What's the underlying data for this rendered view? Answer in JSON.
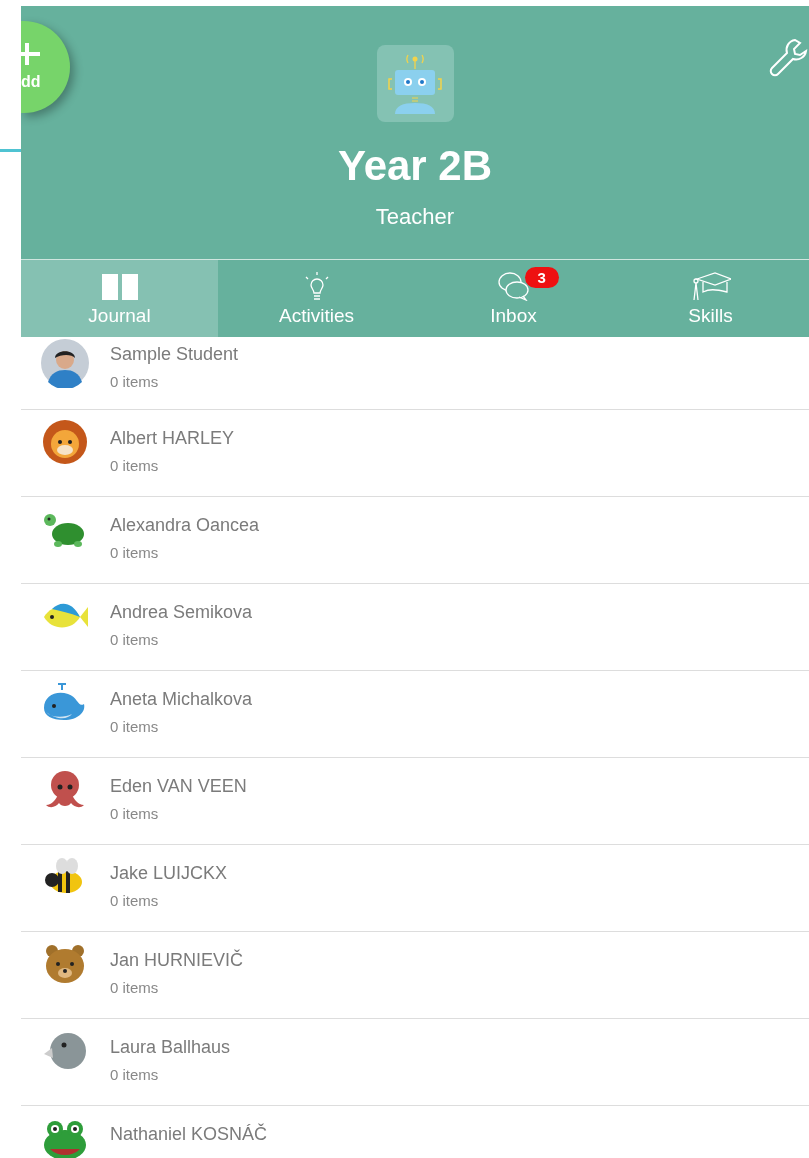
{
  "add_button": {
    "label": "dd"
  },
  "header": {
    "title": "Year 2B",
    "subtitle": "Teacher"
  },
  "tabs": [
    {
      "label": "Journal",
      "kind": "book",
      "selected": true
    },
    {
      "label": "Activities",
      "kind": "bulb",
      "selected": false
    },
    {
      "label": "Inbox",
      "kind": "chat",
      "selected": false,
      "badge": "3"
    },
    {
      "label": "Skills",
      "kind": "cap",
      "selected": false
    }
  ],
  "students": [
    {
      "name": "Sample Student",
      "items": "0 items",
      "kind": "person"
    },
    {
      "name": "Albert HARLEY",
      "items": "0 items",
      "kind": "lion"
    },
    {
      "name": "Alexandra Oancea",
      "items": "0 items",
      "kind": "turtle"
    },
    {
      "name": "Andrea Semikova",
      "items": "0 items",
      "kind": "fish"
    },
    {
      "name": "Aneta Michalkova",
      "items": "0 items",
      "kind": "whale"
    },
    {
      "name": "Eden VAN VEEN",
      "items": "0 items",
      "kind": "octopus"
    },
    {
      "name": "Jake LUIJCKX",
      "items": "0 items",
      "kind": "bee"
    },
    {
      "name": "Jan HURNIEVIČ",
      "items": "0 items",
      "kind": "bear"
    },
    {
      "name": "Laura Ballhaus",
      "items": "0 items",
      "kind": "bird"
    },
    {
      "name": "Nathaniel KOSNÁČ",
      "kind": "frog"
    }
  ]
}
